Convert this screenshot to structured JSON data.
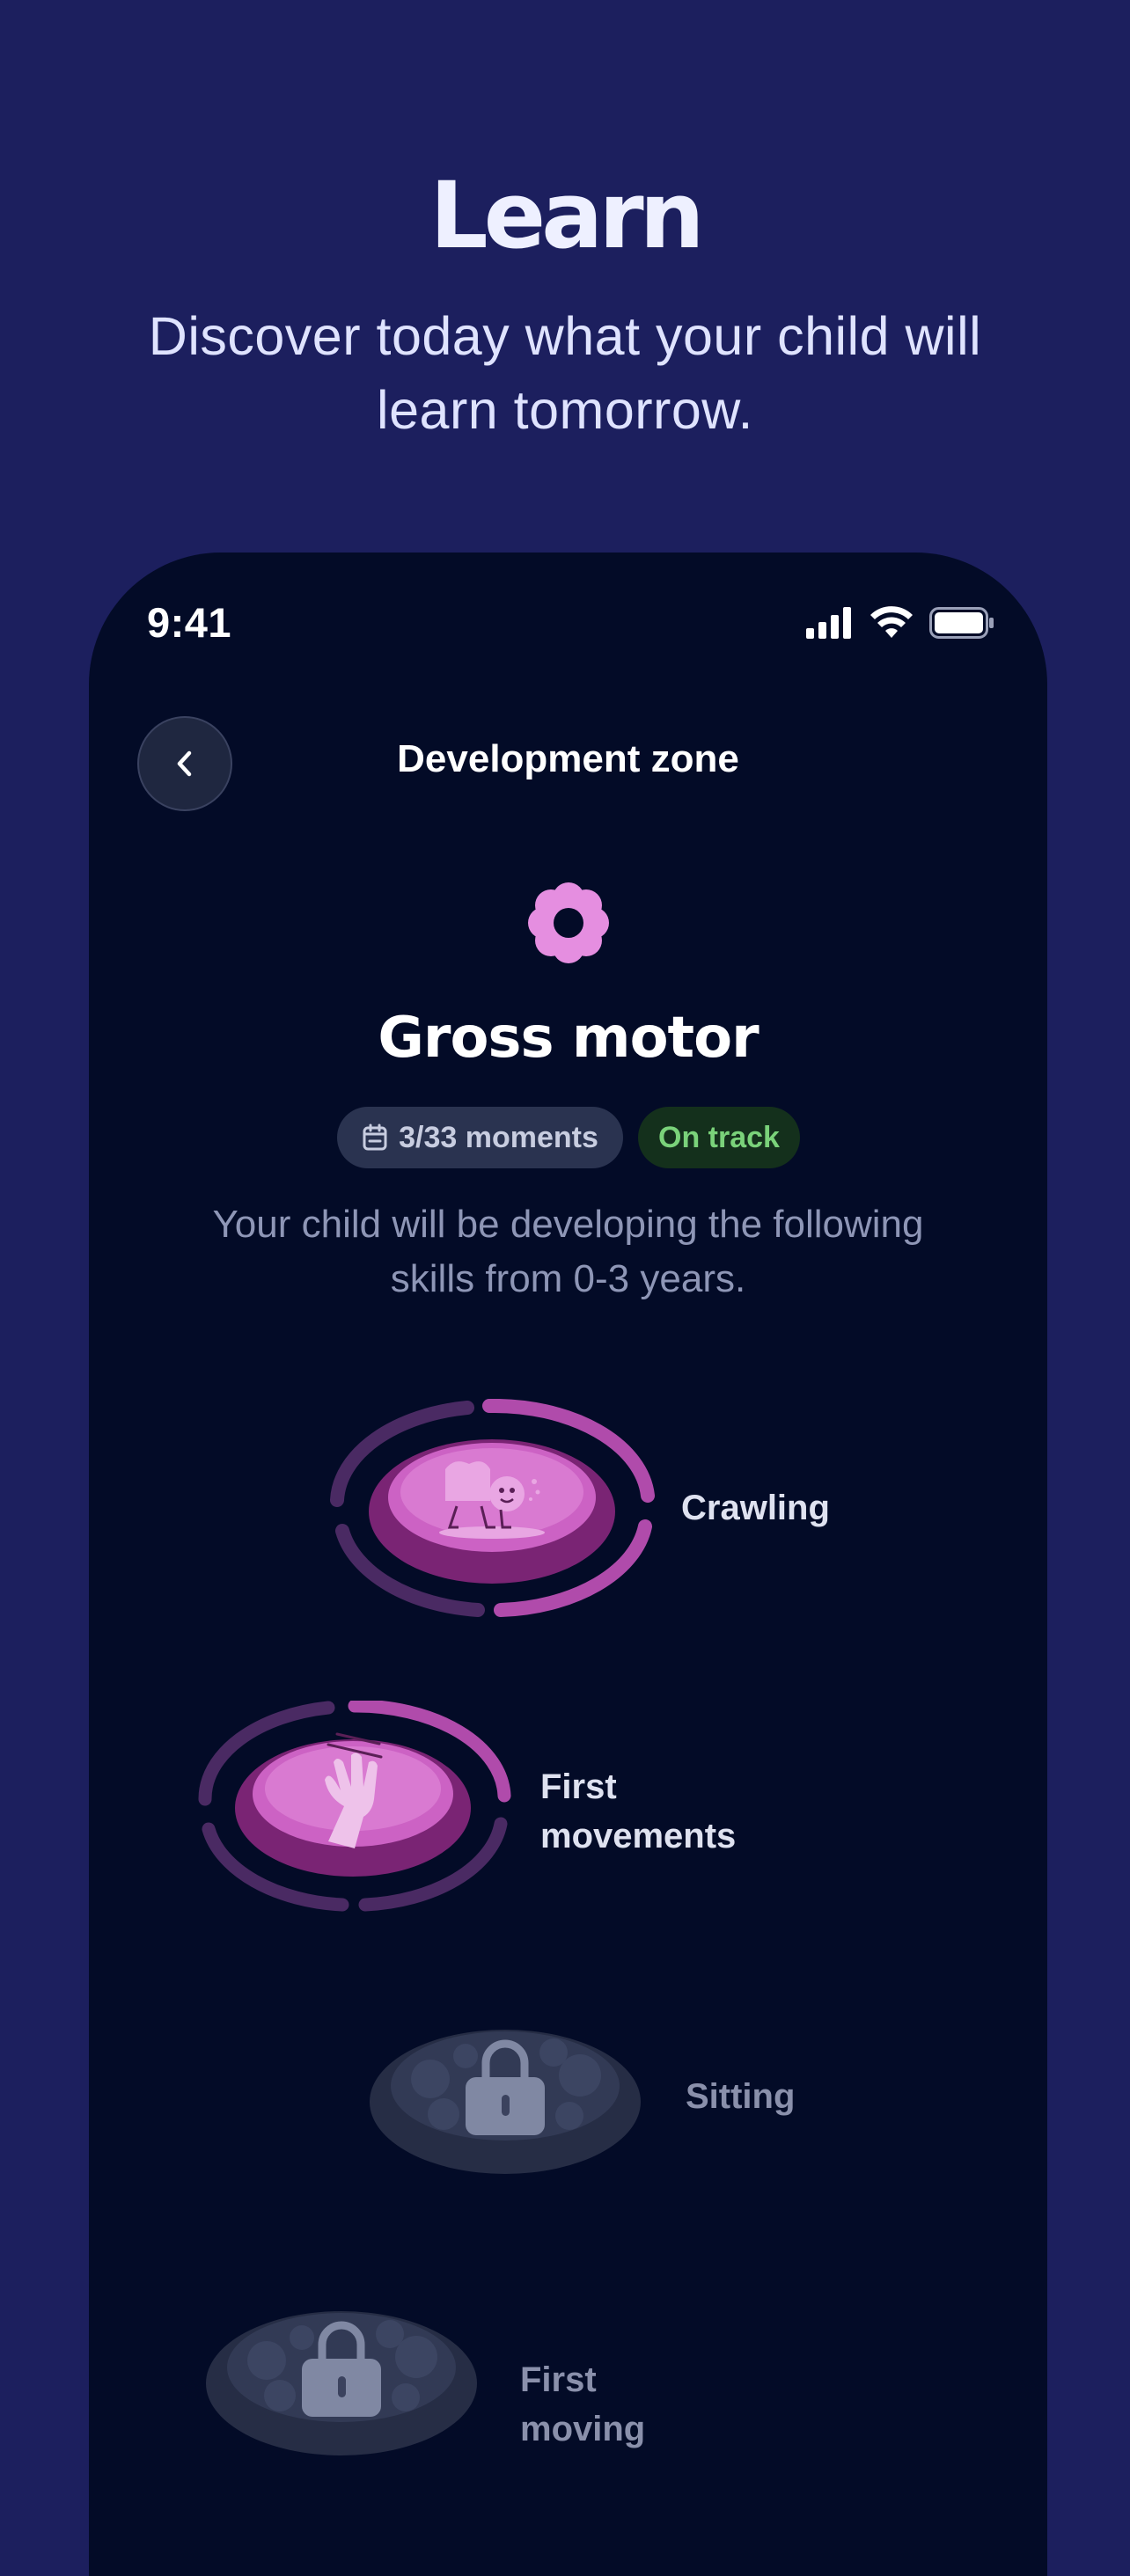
{
  "hero": {
    "title": "Learn",
    "subtitle": "Discover today what your child will learn tomorrow."
  },
  "status_bar": {
    "time": "9:41",
    "icons": [
      "signal-icon",
      "wifi-icon",
      "battery-icon"
    ]
  },
  "nav": {
    "back_icon": "chevron-left-icon",
    "title": "Development zone"
  },
  "zone": {
    "icon": "flower-icon",
    "title": "Gross motor",
    "moments_icon": "calendar-icon",
    "moments": "3/33 moments",
    "status": "On track",
    "description": "Your child will be developing the following skills from 0-3 years."
  },
  "skills": [
    {
      "label": "Crawling",
      "state": "unlocked",
      "icon": "crawling-baby-icon"
    },
    {
      "label_line1": "First",
      "label_line2": "movements",
      "state": "unlocked",
      "icon": "waving-hand-icon"
    },
    {
      "label": "Sitting",
      "state": "locked",
      "icon": "lock-icon"
    },
    {
      "label": "First moving",
      "state": "locked",
      "icon": "lock-icon"
    }
  ],
  "colors": {
    "background": "#1c1f5e",
    "phone": "#030b27",
    "accent_pink": "#c65bbd",
    "on_track_text": "#7ad27a",
    "on_track_bg": "#14301c",
    "locked": "#3a415a"
  }
}
